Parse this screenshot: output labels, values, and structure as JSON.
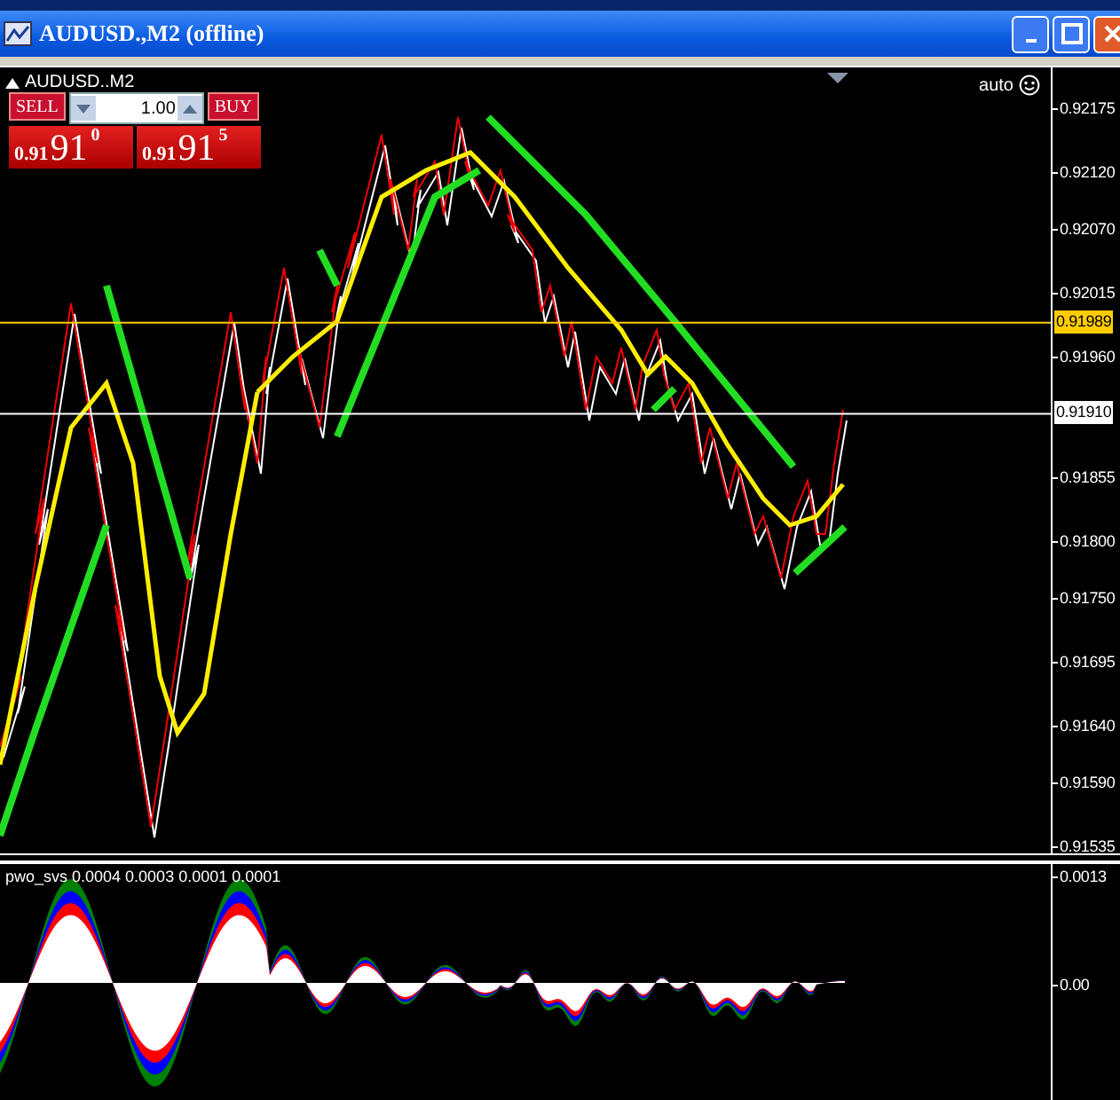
{
  "window": {
    "title": "AUDUSD.,M2 (offline)"
  },
  "chart": {
    "symbol_label": "AUDUSD..M2",
    "auto_label": "auto",
    "trade_panel": {
      "sell_label": "SELL",
      "buy_label": "BUY",
      "lot": "1.00",
      "sell_price": {
        "prefix": "0.91",
        "big": "91",
        "sup": "0"
      },
      "buy_price": {
        "prefix": "0.91",
        "big": "91",
        "sup": "5"
      }
    },
    "price_axis": [
      "0.92175",
      "0.92120",
      "0.92070",
      "0.92015",
      "0.91960",
      "0.91855",
      "0.91800",
      "0.91750",
      "0.91695",
      "0.91640",
      "0.91590",
      "0.91535"
    ],
    "price_lines": [
      {
        "label": "0.91989",
        "color": "#ffcc00"
      },
      {
        "label": "0.91910",
        "color": "#ffffff"
      }
    ]
  },
  "indicator": {
    "label": "pwo_svs 0.0004 0.0003 0.0001 0.0001",
    "axis": [
      "0.0013",
      "0.00"
    ]
  }
}
